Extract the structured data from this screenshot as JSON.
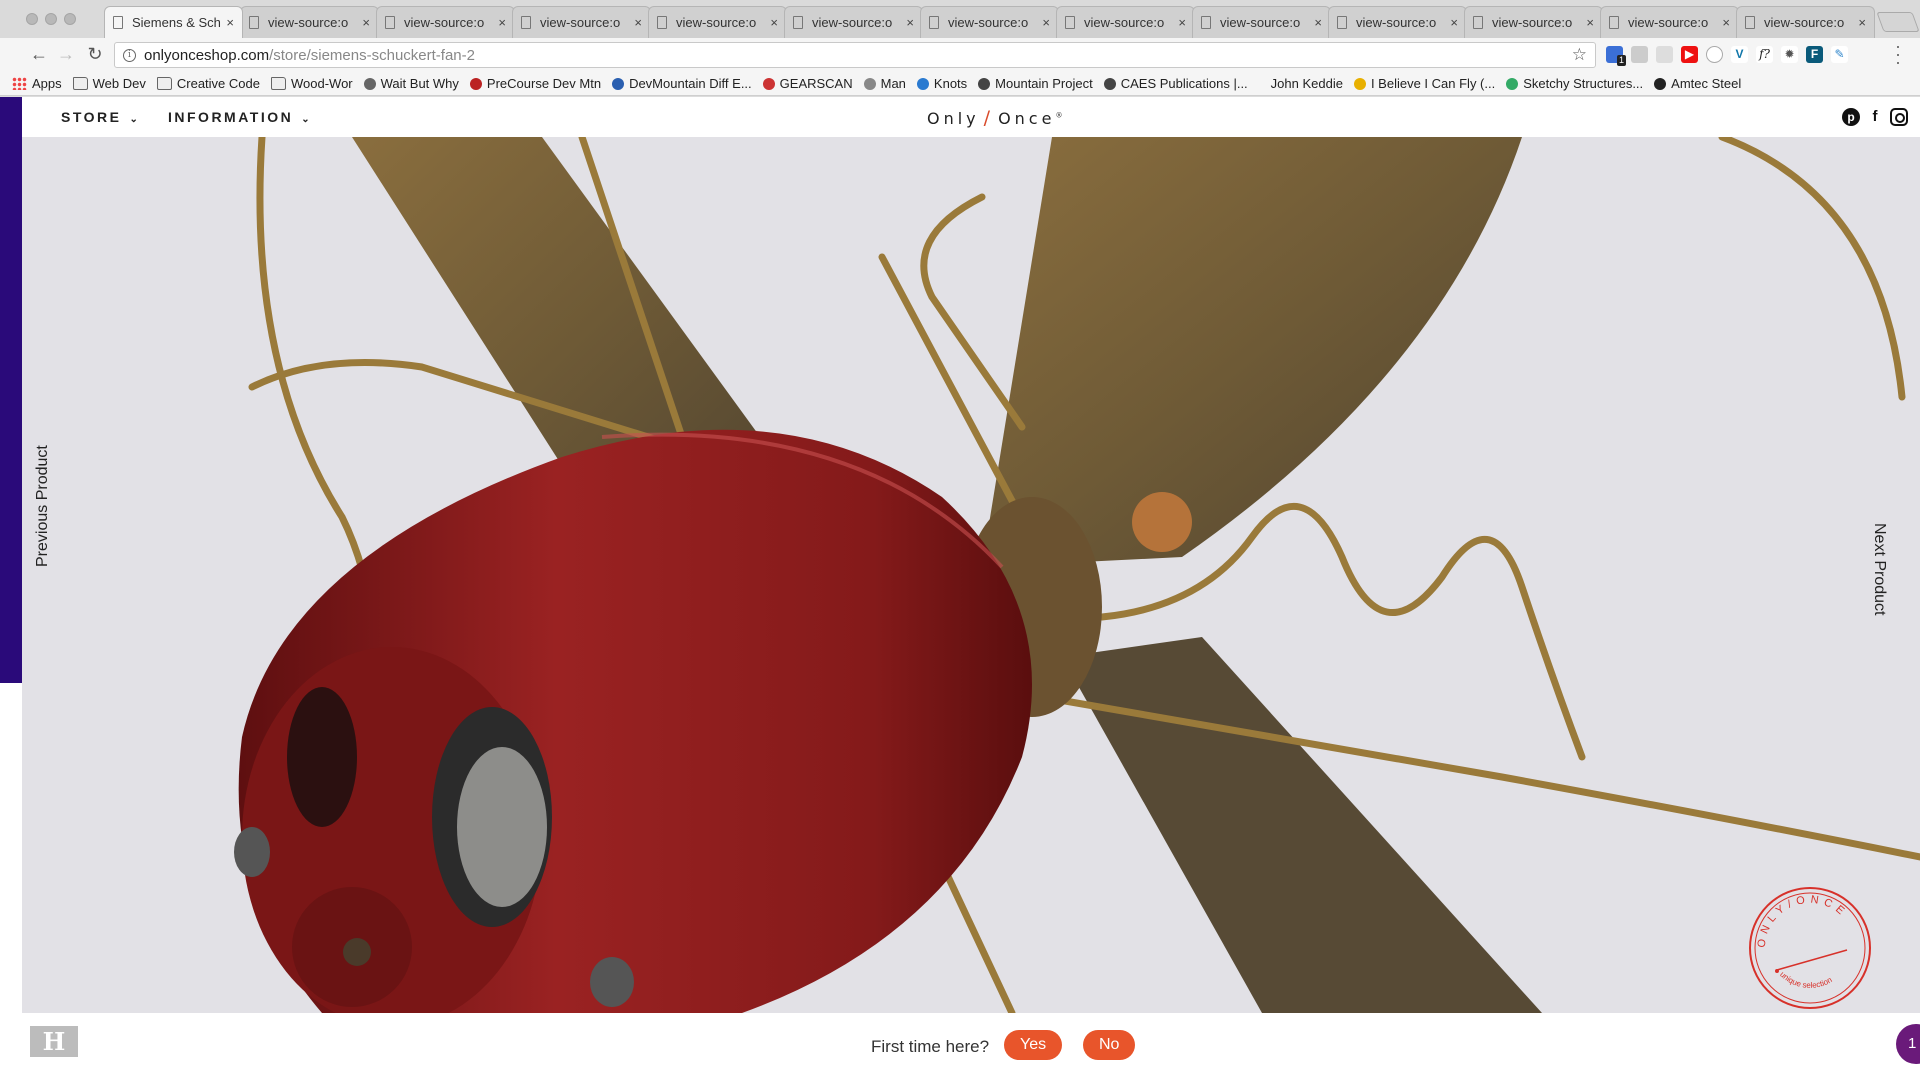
{
  "browser": {
    "tabs": [
      {
        "label": "Siemens & Sch",
        "active": true
      },
      {
        "label": "view-source:o"
      },
      {
        "label": "view-source:o"
      },
      {
        "label": "view-source:o"
      },
      {
        "label": "view-source:o"
      },
      {
        "label": "view-source:o"
      },
      {
        "label": "view-source:o"
      },
      {
        "label": "view-source:o"
      },
      {
        "label": "view-source:o"
      },
      {
        "label": "view-source:o"
      },
      {
        "label": "view-source:o"
      },
      {
        "label": "view-source:o"
      },
      {
        "label": "view-source:o"
      }
    ],
    "close_glyph": "×",
    "url_host": "onlyonceshop.com",
    "url_path": "/store/siemens-schuckert-fan-2",
    "extension_badge": "1",
    "bookmarks": [
      {
        "label": "Apps",
        "icon": "apps-grid-icon"
      },
      {
        "label": "Web Dev",
        "icon": "folder-icon"
      },
      {
        "label": "Creative Code",
        "icon": "folder-icon"
      },
      {
        "label": "Wood-Wor",
        "icon": "folder-icon"
      },
      {
        "label": "Wait But Why",
        "icon": "site-icon"
      },
      {
        "label": "PreCourse Dev Mtn",
        "icon": "site-icon"
      },
      {
        "label": "DevMountain Diff E...",
        "icon": "site-icon"
      },
      {
        "label": "GEARSCAN",
        "icon": "site-icon"
      },
      {
        "label": "Man",
        "icon": "site-icon"
      },
      {
        "label": "Knots",
        "icon": "site-icon"
      },
      {
        "label": "Mountain Project",
        "icon": "site-icon"
      },
      {
        "label": "CAES Publications |...",
        "icon": "site-icon"
      },
      {
        "label": "John Keddie",
        "icon": "none"
      },
      {
        "label": "I Believe I Can Fly (...",
        "icon": "site-icon"
      },
      {
        "label": "Sketchy Structures...",
        "icon": "site-icon"
      },
      {
        "label": "Amtec Steel",
        "icon": "site-icon"
      }
    ]
  },
  "site": {
    "nav": {
      "store": "STORE",
      "information": "INFORMATION"
    },
    "logo": {
      "left": "Only",
      "slash": "/",
      "right": "Once",
      "mark": "®"
    },
    "prev_product": "Previous Product",
    "next_product": "Next Product",
    "stamp": {
      "top_text": "ONLY/ONCE",
      "bottom_text": "unique selection"
    },
    "first_time": {
      "question": "First time here?",
      "yes": "Yes",
      "no": "No"
    },
    "chat_count": "1",
    "colors": {
      "accent": "#e8552b",
      "purple": "#2a0a7a",
      "fan_red": "#8e1c1c",
      "brass": "#8a6a2c"
    }
  }
}
